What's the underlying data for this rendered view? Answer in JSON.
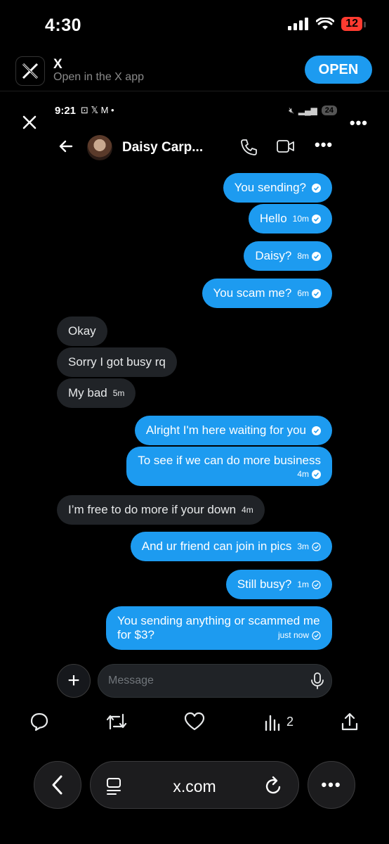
{
  "status_bar": {
    "time": "4:30",
    "battery": "12"
  },
  "banner": {
    "app_name": "X",
    "subtitle": "Open in the X app",
    "open_label": "OPEN"
  },
  "inner_status": {
    "time": "9:21",
    "battery": "24"
  },
  "chat": {
    "contact_name": "Daisy Carp...",
    "messages": [
      {
        "dir": "out",
        "text": "You sending?",
        "time": ""
      },
      {
        "dir": "out",
        "text": "Hello",
        "time": "10m"
      },
      {
        "dir": "out",
        "text": "Daisy?",
        "time": "8m"
      },
      {
        "dir": "out",
        "text": "You scam me?",
        "time": "6m"
      },
      {
        "dir": "in",
        "text": "Okay",
        "time": ""
      },
      {
        "dir": "in",
        "text": "Sorry I got busy rq",
        "time": ""
      },
      {
        "dir": "in",
        "text": "My bad",
        "time": "5m"
      },
      {
        "dir": "out",
        "text": "Alright I'm here waiting for you",
        "time": ""
      },
      {
        "dir": "out",
        "text": "To see if we can do more business",
        "time": "4m"
      },
      {
        "dir": "in",
        "text": "I’m free to do more if your down",
        "time": "4m"
      },
      {
        "dir": "out",
        "text": "And ur friend can join in pics",
        "time": "3m"
      },
      {
        "dir": "out",
        "text": "Still busy?",
        "time": "1m"
      },
      {
        "dir": "out",
        "text_line1": "You sending anything or scammed me",
        "text_line2": "for $3?",
        "time": "just now"
      }
    ],
    "composer_placeholder": "Message"
  },
  "tweet_actions": {
    "views": "2"
  },
  "browser": {
    "url": "x.com"
  },
  "colors": {
    "accent": "#1d9bf0",
    "incoming_bubble": "#202327",
    "background": "#000000"
  },
  "icons": [
    "signal-icon",
    "wifi-icon",
    "x-logo-icon",
    "close-icon",
    "back-arrow-icon",
    "phone-icon",
    "video-icon",
    "more-icon",
    "check-icon",
    "plus-icon",
    "mic-icon",
    "reply-icon",
    "retweet-icon",
    "like-icon",
    "views-icon",
    "share-icon",
    "browser-back-icon",
    "tabs-icon",
    "reload-icon"
  ]
}
